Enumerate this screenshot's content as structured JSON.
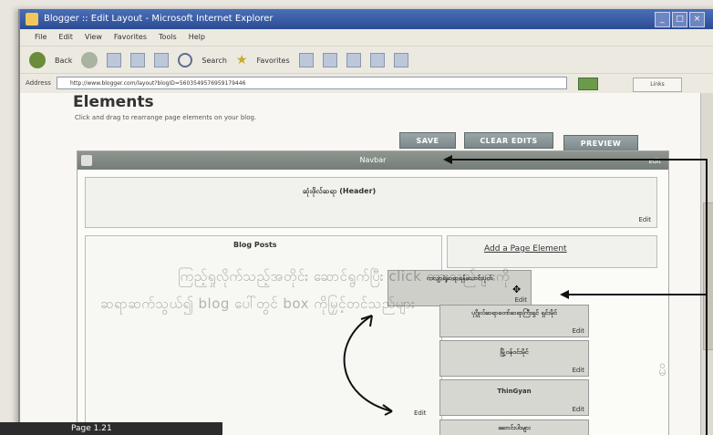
{
  "window": {
    "title": "Blogger :: Edit Layout - Microsoft Internet Explorer",
    "controls": [
      "_",
      "□",
      "×"
    ]
  },
  "menu": [
    "File",
    "Edit",
    "View",
    "Favorites",
    "Tools",
    "Help"
  ],
  "toolbar": {
    "back_label": "Back",
    "search_label": "Search",
    "favorites_label": "Favorites"
  },
  "address": {
    "label": "Address",
    "url": "http://www.blogger.com/layout?blogID=5603549576959179446",
    "go_label": "Go",
    "links_label": "Links"
  },
  "page": {
    "title": "Elements",
    "hint": "Click and drag to rearrange page elements on your blog."
  },
  "actions": {
    "save": "SAVE",
    "clear": "CLEAR EDITS",
    "preview": "PREVIEW"
  },
  "layout": {
    "navbar_label": "Navbar",
    "navbar_edit": "Edit",
    "header_label": "ဆုံးဖိုလ်ဆရာ (Header)",
    "header_edit": "Edit",
    "blog_posts_label": "Blog Posts",
    "add_element": "Add a Page Element",
    "left_edit": "Edit",
    "gadgets": [
      {
        "title": "ကလျာရဲ့ဆရာရန်သောင်းပုတ်",
        "edit": "Edit"
      },
      {
        "title": "ပုဂ္ဂိုလ်ဆရာတော်ဆရာကြီးရှင် ရှင်းမိုင်",
        "edit": "Edit"
      },
      {
        "title": "မြို့ဝန်ဝင်းမိုင်",
        "edit": "Edit"
      },
      {
        "title": "ThinGyan",
        "edit": "Edit"
      },
      {
        "title": "ဆောင်းပါးများ",
        "edit": ""
      }
    ]
  },
  "overlay": {
    "line1": "ကြည့်ရှုလိုက်သည့်အတိုင်း ဆောင်ရွက်ပြီး click ထားသည်များကို",
    "line2": "ဆရာဆက်သွယ်၍ blog ပေါ်တွင် box ကိုမြှင့်တင်သည်များ",
    "line3": "မိ"
  },
  "caption": "Page 1.21"
}
